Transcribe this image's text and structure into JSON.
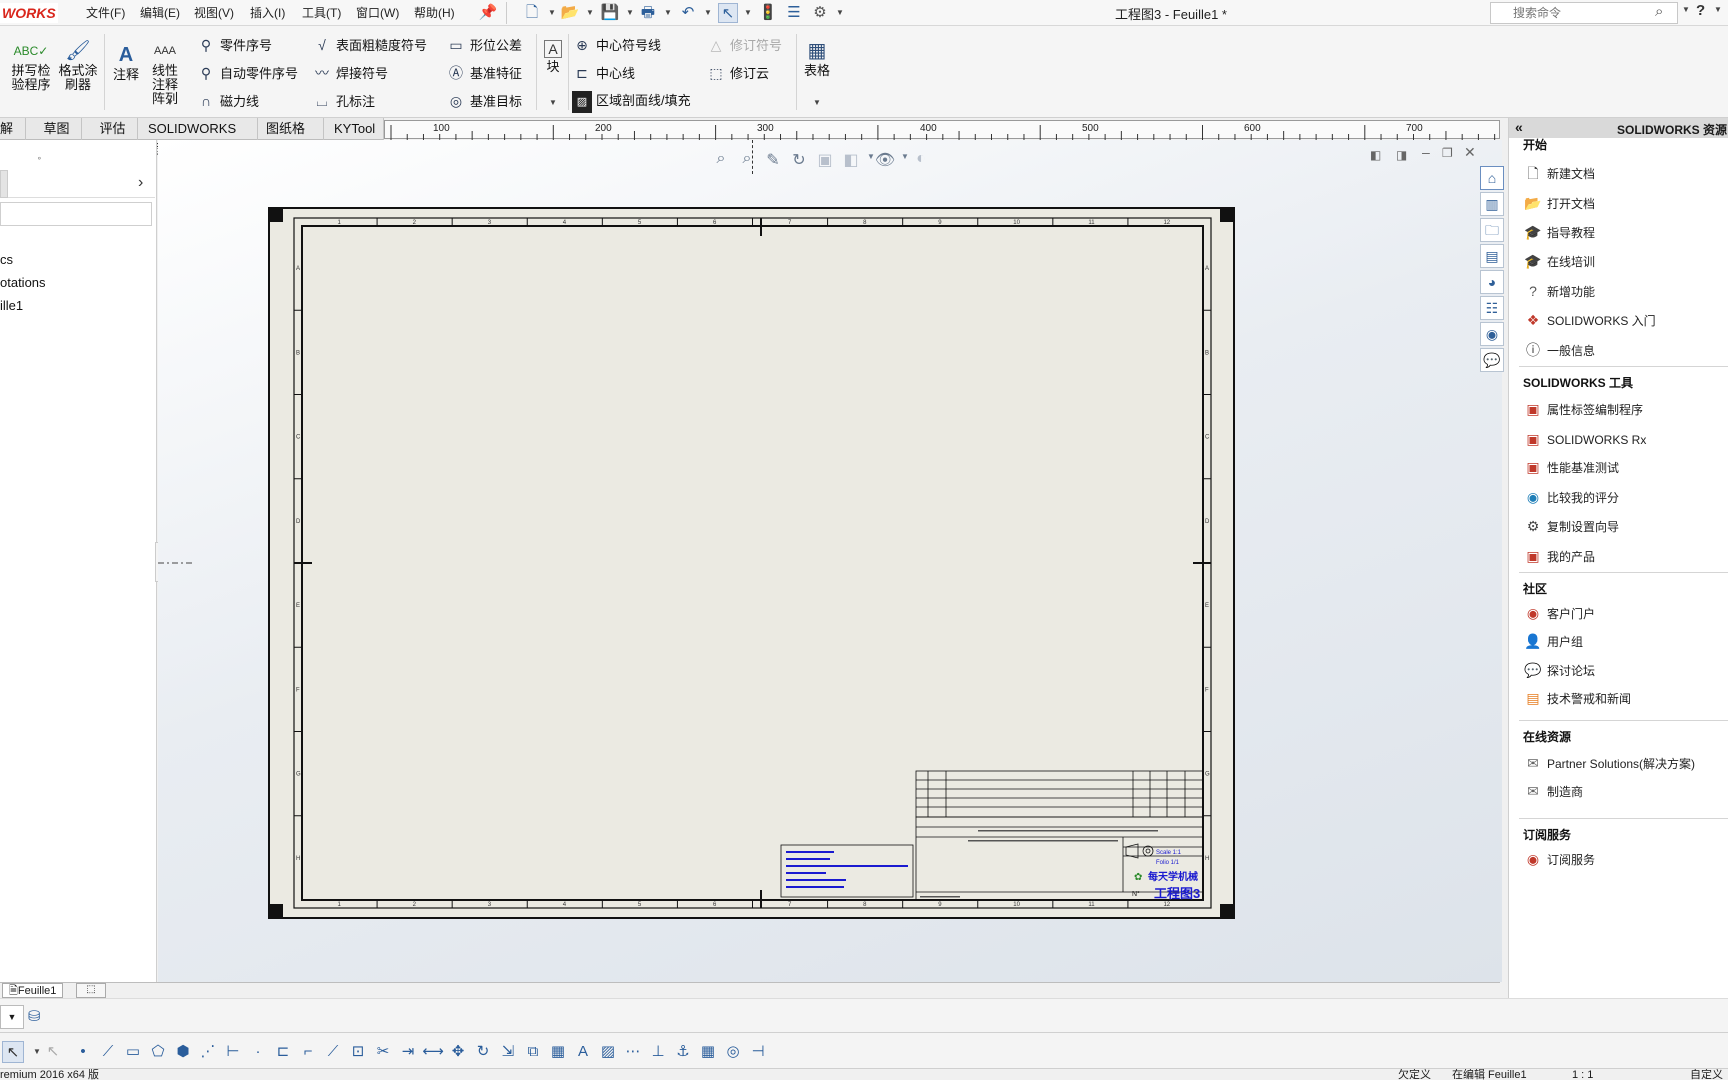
{
  "app": {
    "logo_text": "WORKS",
    "document_title": "工程图3 - Feuille1 *"
  },
  "menu": [
    "文件(F)",
    "编辑(E)",
    "视图(V)",
    "插入(I)",
    "工具(T)",
    "窗口(W)",
    "帮助(H)"
  ],
  "search": {
    "placeholder": "搜索命令"
  },
  "ribbon": {
    "spell_check": "拼写检验程序",
    "format_painter": "格式涂刷器",
    "note": "注释",
    "linear_note": "线性注释阵列",
    "balloon": "零件序号",
    "auto_balloon": "自动零件序号",
    "magnetic_line": "磁力线",
    "surface_finish": "表面粗糙度符号",
    "weld_symbol": "焊接符号",
    "hole_callout": "孔标注",
    "gtol": "形位公差",
    "datum_feature": "基准特征",
    "datum_target": "基准目标",
    "block": "块",
    "center_mark": "中心符号线",
    "centerline": "中心线",
    "hatch": "区域剖面线/填充",
    "revision_symbol": "修订符号",
    "revision_cloud": "修订云",
    "table": "表格"
  },
  "tabs": [
    "解",
    "草图",
    "评估",
    "SOLIDWORKS 插件",
    "图纸格式",
    "KYTool"
  ],
  "ruler": {
    "labels": [
      "100",
      "200",
      "300",
      "400",
      "500",
      "600",
      "700"
    ]
  },
  "feature_tree": {
    "items": [
      "cs",
      "otations",
      "ille1"
    ]
  },
  "sheet": {
    "border_letters": [
      "A",
      "B",
      "C",
      "D",
      "E",
      "F",
      "G",
      "H"
    ],
    "border_numbers": [
      "1",
      "2",
      "3",
      "4",
      "5",
      "6",
      "7",
      "8",
      "9",
      "10",
      "11",
      "12"
    ],
    "company": "每天学机械",
    "drawing_title": "工程图3",
    "scale_label": "Scale 1:1",
    "folio_label": "Folio 1/1",
    "number_label": "N°"
  },
  "task_pane": {
    "header": "SOLIDWORKS 资源",
    "sections": [
      {
        "title": "开始",
        "items": [
          "新建文档",
          "打开文档",
          "指导教程",
          "在线培训",
          "新增功能",
          "SOLIDWORKS 入门",
          "一般信息"
        ]
      },
      {
        "title": "SOLIDWORKS 工具",
        "items": [
          "属性标签编制程序",
          "SOLIDWORKS Rx",
          "性能基准测试",
          "比较我的评分",
          "复制设置向导",
          "我的产品"
        ]
      },
      {
        "title": "社区",
        "items": [
          "客户门户",
          "用户组",
          "探讨论坛",
          "技术警戒和新闻"
        ]
      },
      {
        "title": "在线资源",
        "items": [
          "Partner Solutions(解决方案)",
          "制造商"
        ]
      },
      {
        "title": "订阅服务",
        "items": [
          "订阅服务"
        ]
      }
    ]
  },
  "sheet_tab": {
    "label": "Feuille1"
  },
  "status": {
    "version": "remium 2016 x64 版",
    "state_1": "欠定义",
    "state_2": "在编辑 Feuille1",
    "scale": "1 : 1",
    "units": "自定义"
  },
  "colors": {
    "accent": "#2a5d9b",
    "logo": "#d9261c",
    "sheet_paper": "#ebeae2"
  }
}
